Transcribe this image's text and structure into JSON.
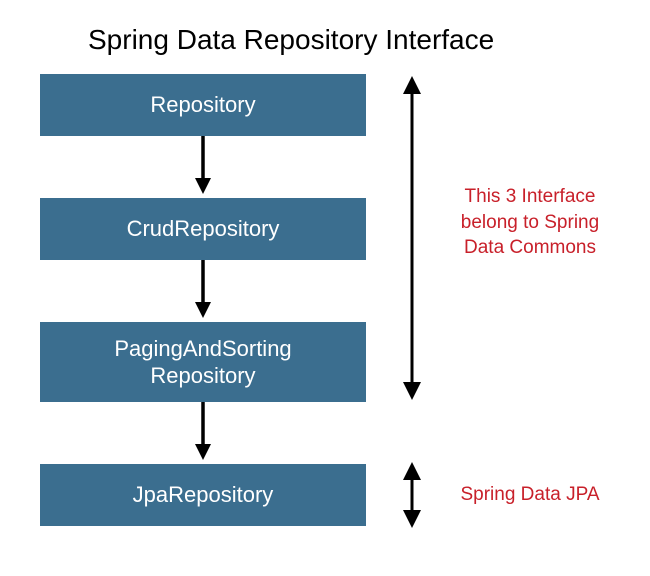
{
  "title": "Spring Data Repository Interface",
  "boxes": {
    "repository": "Repository",
    "crud": "CrudRepository",
    "paging": "PagingAndSorting\nRepository",
    "jpa": "JpaRepository"
  },
  "annotations": {
    "commons": "This 3 Interface belong to Spring Data Commons",
    "jpa": "Spring Data JPA"
  },
  "colors": {
    "box_fill": "#3b6e8f",
    "arrow": "#000000",
    "annotation_text": "#c8202a"
  }
}
